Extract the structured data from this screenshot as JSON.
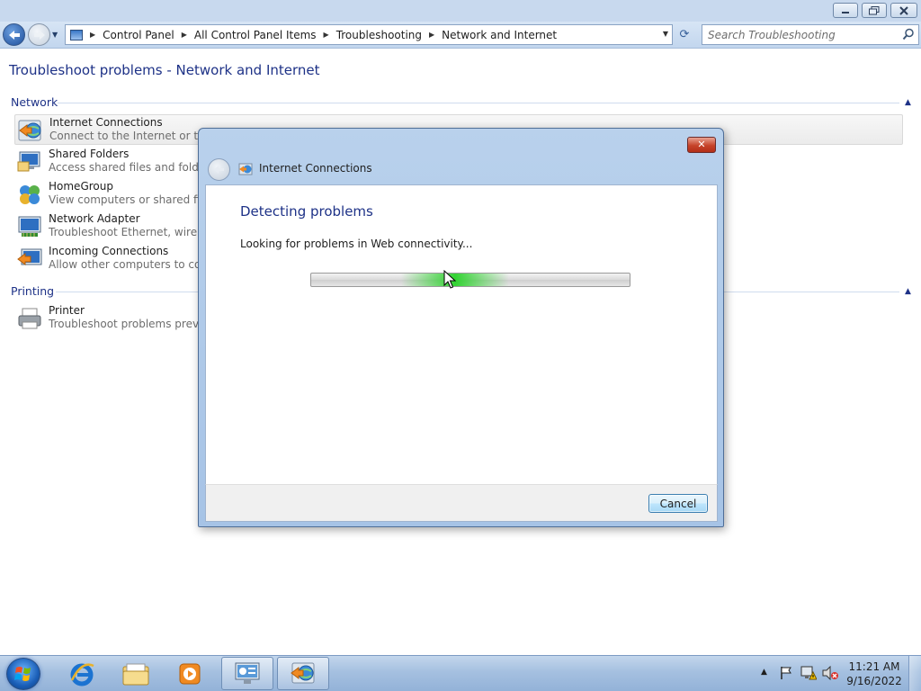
{
  "window": {
    "minimize_label": "—",
    "maximize_label": "❐",
    "close_label": "✕"
  },
  "nav": {
    "breadcrumbs": [
      "Control Panel",
      "All Control Panel Items",
      "Troubleshooting",
      "Network and Internet"
    ],
    "search_placeholder": "Search Troubleshooting",
    "refresh_label": "⟳"
  },
  "main": {
    "title": "Troubleshoot problems - Network and Internet",
    "groups": [
      {
        "header": "Network",
        "items": [
          {
            "name": "Internet Connections",
            "desc": "Connect to the Internet or to a particular website"
          },
          {
            "name": "Shared Folders",
            "desc": "Access shared files and folders on other computers"
          },
          {
            "name": "HomeGroup",
            "desc": "View computers or shared files in a homegroup"
          },
          {
            "name": "Network Adapter",
            "desc": "Troubleshoot Ethernet, wireless, or other network adapters"
          },
          {
            "name": "Incoming Connections",
            "desc": "Allow other computers to connect to your computer"
          }
        ]
      },
      {
        "header": "Printing",
        "items": [
          {
            "name": "Printer",
            "desc": "Troubleshoot problems preventing printing"
          }
        ]
      }
    ]
  },
  "dialog": {
    "close_label": "✕",
    "title": "Internet Connections",
    "heading": "Detecting problems",
    "status": "Looking for problems in Web connectivity...",
    "cancel_label": "Cancel",
    "progress_mode": "marquee"
  },
  "taskbar": {
    "time": "11:21 AM",
    "date": "9/16/2022"
  },
  "colors": {
    "link_blue": "#1e3287",
    "muted_text": "#6d6d6d",
    "progress_green": "#28d228"
  }
}
